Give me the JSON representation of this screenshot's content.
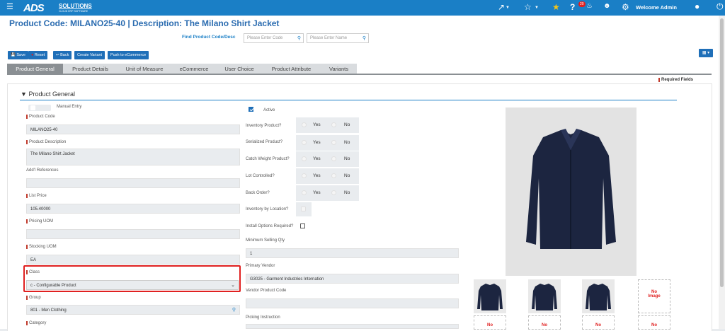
{
  "topbar": {
    "menu_icon": "hamburger-icon",
    "logo_text": "ADS",
    "logo_solutions": "SOLUTIONS",
    "logo_tagline": "CLOUD ERP SOFTWARE",
    "notification_count": "20",
    "welcome": "Welcome Admin",
    "brand_color": "#1a7fc6"
  },
  "page": {
    "title": "Product Code:  MILANO25-40 | Description: The Milano Shirt Jacket",
    "find_label": "Find Product Code/Desc",
    "code_placeholder": "Please Enter Code",
    "name_placeholder": "Please Enter Name",
    "required_fields": "Required Fields"
  },
  "toolbar": {
    "save": "Save",
    "reset": "Reset",
    "back": "Back",
    "create_variant": "Create Variant",
    "push": "Push to eCommerce"
  },
  "tabs": [
    "Product General",
    "Product Details",
    "Unit of Measure",
    "eCommerce",
    "User Choice",
    "Product Attribute",
    "Variants"
  ],
  "section": {
    "title": "Product General"
  },
  "left": {
    "manual_entry": "Manual Entry",
    "product_code_label": "Product Code",
    "product_code": "MILANO25-40",
    "description_label": "Product Description",
    "description": "The Milano Shirt Jacket",
    "refs_label": "Add'l References",
    "refs": "",
    "list_price_label": "List Price",
    "list_price": "105.40000",
    "pricing_uom_label": "Pricing UOM",
    "pricing_uom": "",
    "stocking_uom_label": "Stocking UOM",
    "stocking_uom": "EA",
    "class_label": "Class",
    "class_value": "c - Configurable Product",
    "group_label": "Group",
    "group_value": "801 - Men Clothing",
    "category_label": "Category"
  },
  "mid": {
    "active": "Active",
    "inventory": "Inventory Product?",
    "serialized": "Serialized Product?",
    "catch_weight": "Catch Weight Product?",
    "lot": "Lot Controlled?",
    "back_order": "Back Order?",
    "inv_by_loc": "Inventory by Location?",
    "install_options": "Install Options Required?",
    "min_qty_label": "Minimum Selling Qty",
    "min_qty": "1",
    "primary_vendor_label": "Primary Vendor",
    "primary_vendor": "G3025 - Garment Industries Internation",
    "vendor_code_label": "Vendor Product Code",
    "vendor_code": "",
    "picking_label": "Picking Instruction",
    "yes": "Yes",
    "no": "No"
  },
  "images": {
    "no_image_1": "No",
    "no_image_2": "Image"
  }
}
